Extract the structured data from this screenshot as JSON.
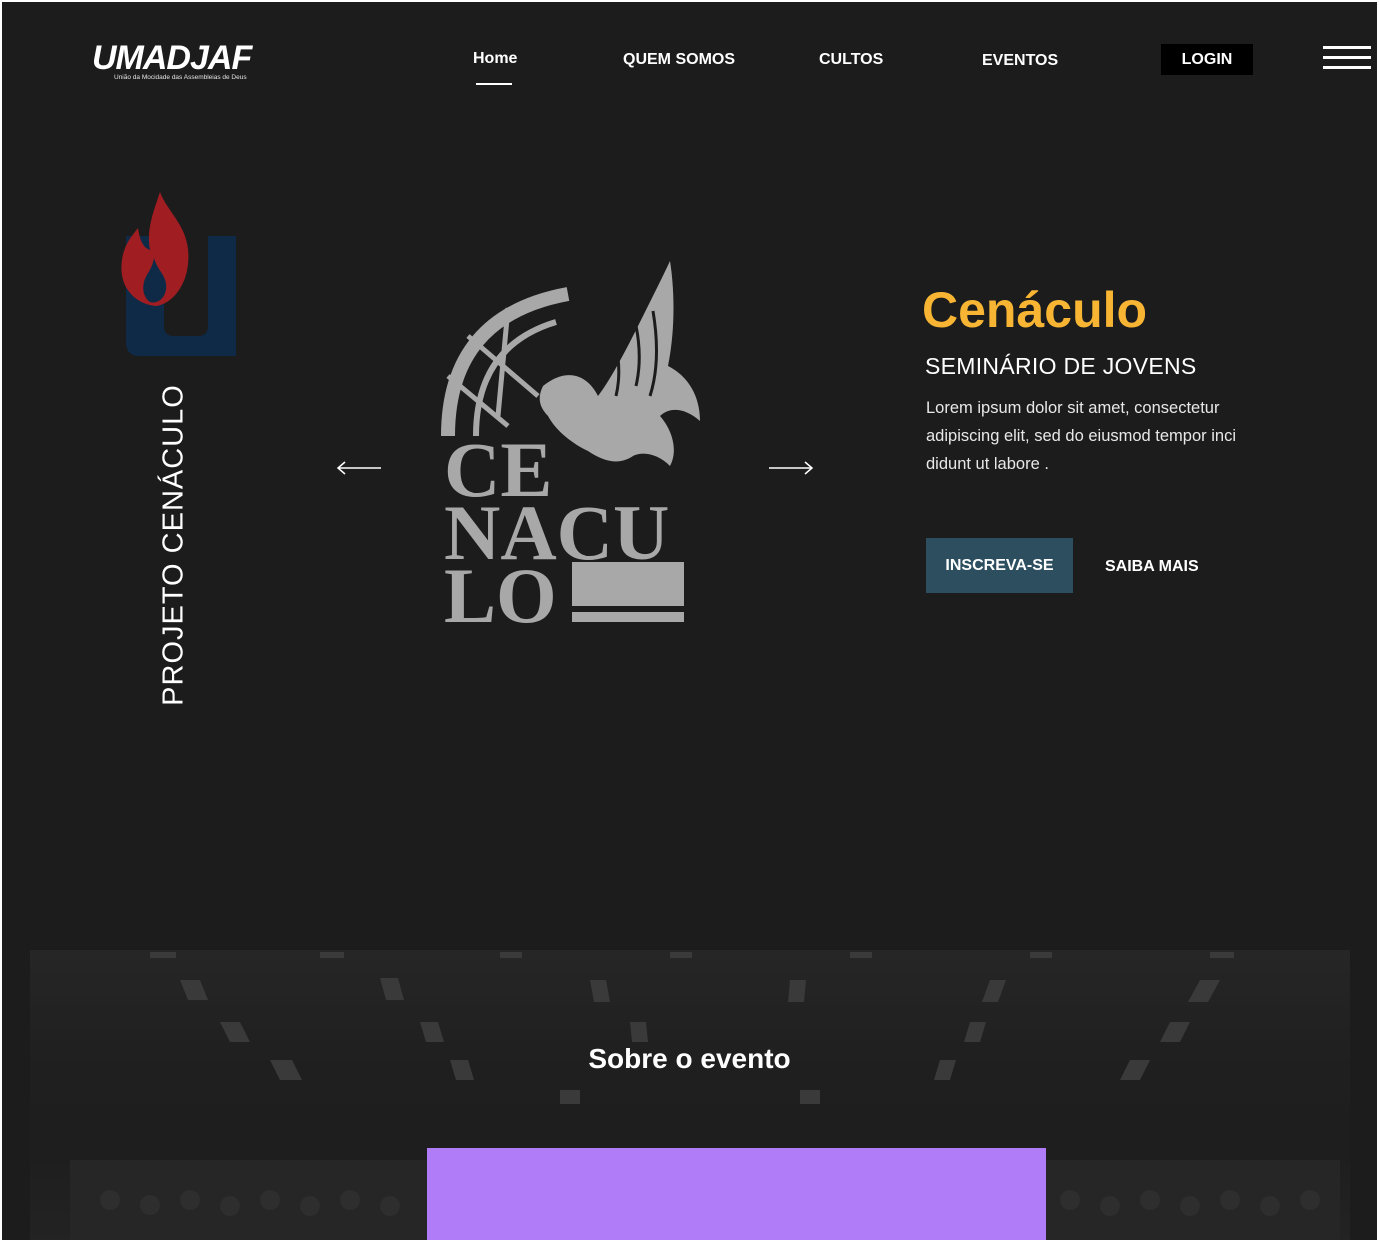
{
  "brand": {
    "logo_text": "UMADJAF",
    "logo_subtitle": "União da Mocidade das Assembleias de Deus"
  },
  "nav": {
    "items": [
      {
        "label": "Home",
        "active": true
      },
      {
        "label": "QUEM SOMOS"
      },
      {
        "label": "CULTOS"
      },
      {
        "label": "EVENTOS"
      }
    ],
    "login_label": "LOGIN",
    "menu_icon": "hamburger-icon"
  },
  "hero": {
    "vertical_title": "PROJETO CENÁCULO",
    "title": "Cenáculo",
    "subtitle": "SEMINÁRIO DE JOVENS",
    "description": "Lorem ipsum dolor sit amet, consectetur adipiscing elit, sed do eiusmod tempor inci didunt ut labore .",
    "primary_button": "INSCREVA-SE",
    "secondary_button": "SAIBA MAIS",
    "artwork_lines": [
      "CE",
      "NACU",
      "LO"
    ],
    "prev_icon": "arrow-left-icon",
    "next_icon": "arrow-right-icon"
  },
  "about": {
    "title": "Sobre o evento"
  },
  "colors": {
    "background": "#1c1c1c",
    "accent": "#f7b533",
    "primary_button": "#2c4e5e",
    "purple": "#b07cf7",
    "flame_red": "#a01d22",
    "flame_blue": "#0e2a47",
    "artwork_gray": "#a8a8a8"
  }
}
